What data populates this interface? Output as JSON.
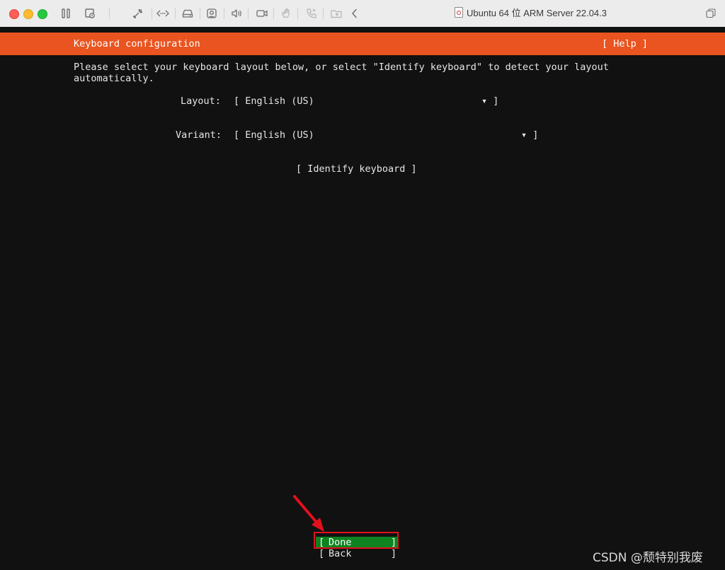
{
  "window": {
    "title": "Ubuntu 64 位 ARM Server 22.04.3",
    "toolbar_icons": [
      "pause-icon",
      "snapshot-icon",
      "wrench-icon",
      "network-icon",
      "disk-icon",
      "camera-icon",
      "sound-icon",
      "video-icon",
      "usb-icon",
      "phone-icon",
      "folder-icon",
      "back-arrow-icon"
    ]
  },
  "installer": {
    "header_title": "Keyboard configuration",
    "help_label": "[ Help ]",
    "instruction_line1": "Please select your keyboard layout below, or select \"Identify keyboard\" to detect your layout",
    "instruction_line2": "automatically.",
    "layout": {
      "label": "Layout:",
      "value": "[ English (US)",
      "arrow": "▾ ]"
    },
    "variant": {
      "label": "Variant:",
      "value": "[ English (US)",
      "arrow": "▾ ]"
    },
    "identify_label": "[ Identify keyboard ]",
    "done": {
      "open": "[",
      "label": "Done",
      "close": "]"
    },
    "back": {
      "open": "[",
      "label": "Back",
      "close": "]"
    }
  },
  "colors": {
    "header_orange": "#e95420",
    "done_green": "#0e8420",
    "annotation_red": "#e3101c"
  },
  "watermark": "CSDN @颓特别我废"
}
